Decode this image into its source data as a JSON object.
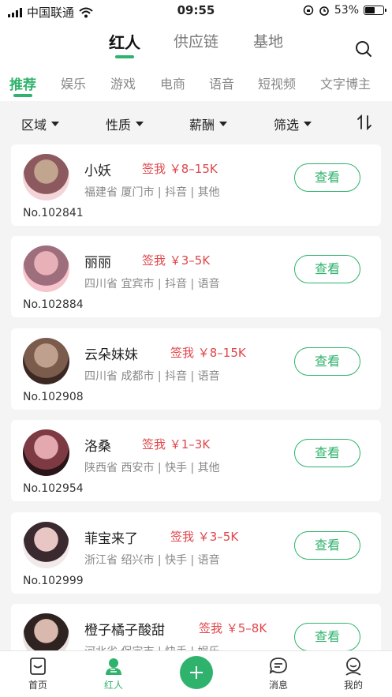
{
  "status_bar": {
    "carrier": "中国联通",
    "time": "09:55",
    "battery": "53%",
    "battery_level": 0.53
  },
  "top_tabs": [
    {
      "label": "红人",
      "active": true
    },
    {
      "label": "供应链"
    },
    {
      "label": "基地"
    }
  ],
  "sub_tabs": [
    {
      "label": "推荐",
      "active": true
    },
    {
      "label": "娱乐"
    },
    {
      "label": "游戏"
    },
    {
      "label": "电商"
    },
    {
      "label": "语音"
    },
    {
      "label": "短视频"
    },
    {
      "label": "文字博主"
    }
  ],
  "filters": [
    {
      "label": "区域"
    },
    {
      "label": "性质"
    },
    {
      "label": "薪酬"
    },
    {
      "label": "筛选"
    }
  ],
  "cards": [
    {
      "name": "小妖",
      "sign": "签我 ￥8–15K",
      "meta": "福建省 厦门市 | 抖音 | 其他",
      "no": "No.102841",
      "button": "查看",
      "avatar_colors": [
        "#f3d4d8",
        "#8c5a5e",
        "#c2a58f"
      ]
    },
    {
      "name": "丽丽",
      "sign": "签我 ￥3–5K",
      "meta": "四川省 宜宾市 | 抖音 | 语音",
      "no": "No.102884",
      "button": "查看",
      "avatar_colors": [
        "#f6c4cc",
        "#9f6e7d",
        "#e8b1b8"
      ]
    },
    {
      "name": "云朵妹妹",
      "sign": "签我 ￥8–15K",
      "meta": "四川省 成都市 | 抖音 | 语音",
      "no": "No.102908",
      "button": "查看",
      "avatar_colors": [
        "#3b2822",
        "#7a5b4c",
        "#bfa08e"
      ]
    },
    {
      "name": "洛桑",
      "sign": "签我 ￥1–3K",
      "meta": "陕西省 西安市 | 快手 | 其他",
      "no": "No.102954",
      "button": "查看",
      "avatar_colors": [
        "#2a1518",
        "#7d3a43",
        "#e3a9ae"
      ]
    },
    {
      "name": "菲宝来了",
      "sign": "签我 ￥3–5K",
      "meta": "浙江省 绍兴市 | 快手 | 语音",
      "no": "No.102999",
      "button": "查看",
      "avatar_colors": [
        "#f2e9ea",
        "#3a2a30",
        "#e7c6c3"
      ]
    },
    {
      "name": "橙子橘子酸甜",
      "sign": "签我 ￥5–8K",
      "meta": "河北省 保定市 | 快手 | 娱乐",
      "no": "",
      "button": "查看",
      "avatar_colors": [
        "#e9e2e0",
        "#2f2321",
        "#d9b8ae"
      ]
    }
  ],
  "tab_bar": [
    {
      "label": "首页",
      "icon": "home-icon"
    },
    {
      "label": "红人",
      "icon": "influencer-icon",
      "active": true
    },
    {
      "label": "",
      "icon": "plus-icon"
    },
    {
      "label": "消息",
      "icon": "message-icon"
    },
    {
      "label": "我的",
      "icon": "profile-icon"
    }
  ],
  "colors": {
    "accent": "#2fb36c",
    "price": "#e0464b"
  }
}
